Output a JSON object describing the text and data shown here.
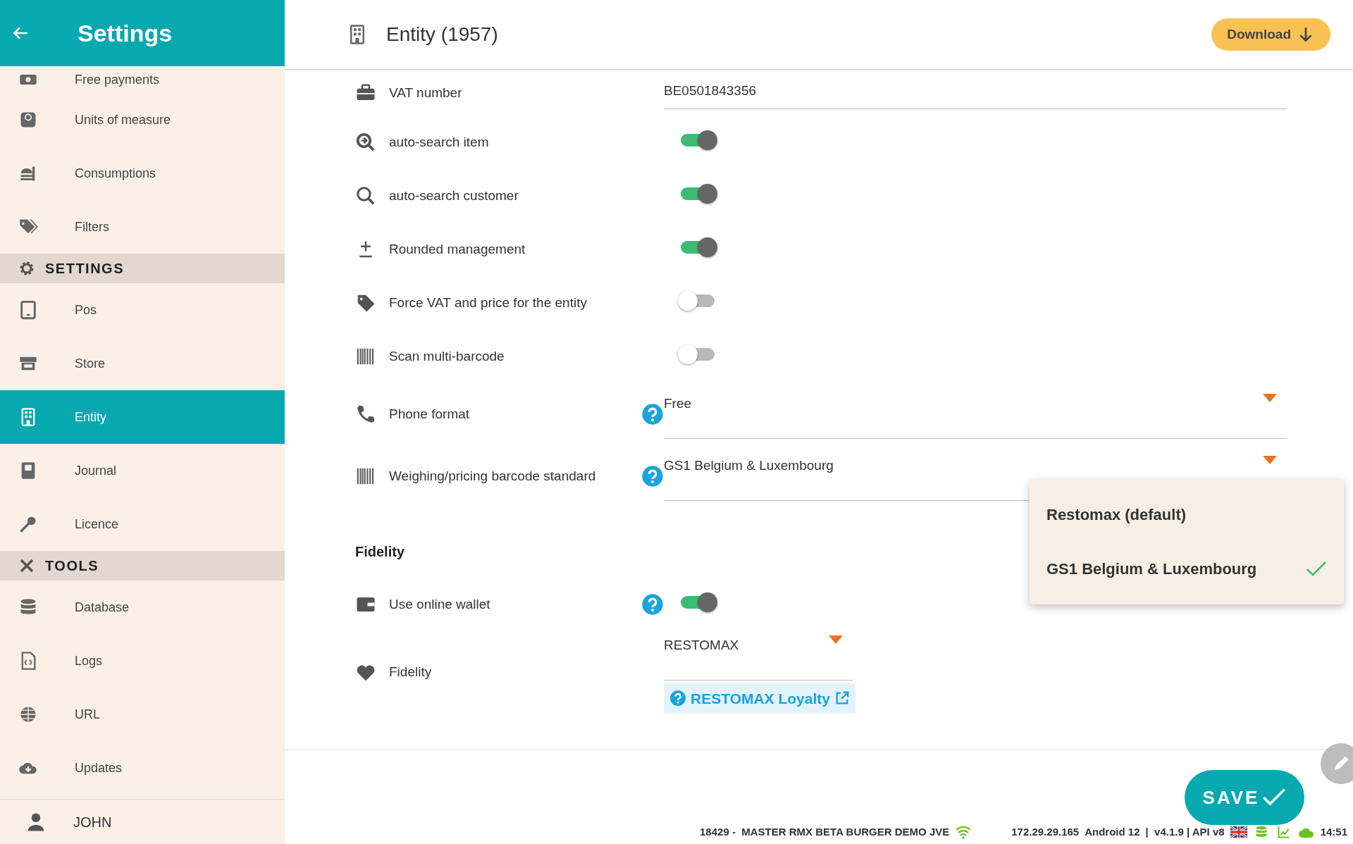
{
  "sidebar": {
    "title": "Settings",
    "items": [
      {
        "kind": "item",
        "label": "Free payments",
        "selected": false
      },
      {
        "kind": "item",
        "label": "Units of measure",
        "selected": false
      },
      {
        "kind": "item",
        "label": "Consumptions",
        "selected": false
      },
      {
        "kind": "item",
        "label": "Filters",
        "selected": false
      },
      {
        "kind": "section",
        "label": "SETTINGS"
      },
      {
        "kind": "item",
        "label": "Pos",
        "selected": false
      },
      {
        "kind": "item",
        "label": "Store",
        "selected": false
      },
      {
        "kind": "item",
        "label": "Entity",
        "selected": true
      },
      {
        "kind": "item",
        "label": "Journal",
        "selected": false
      },
      {
        "kind": "item",
        "label": "Licence",
        "selected": false
      },
      {
        "kind": "section",
        "label": "TOOLS"
      },
      {
        "kind": "item",
        "label": "Database",
        "selected": false
      },
      {
        "kind": "item",
        "label": "Logs",
        "selected": false
      },
      {
        "kind": "item",
        "label": "URL",
        "selected": false
      },
      {
        "kind": "item",
        "label": "Updates",
        "selected": false
      }
    ],
    "user": "JOHN"
  },
  "header": {
    "title": "Entity (1957)",
    "download_button": "Download"
  },
  "settings": [
    {
      "kind": "text",
      "label": "VAT number",
      "value": "BE0501843356",
      "help": false
    },
    {
      "kind": "toggle",
      "label": "auto-search item",
      "on": true,
      "help": false
    },
    {
      "kind": "toggle",
      "label": "auto-search customer",
      "on": true,
      "help": false
    },
    {
      "kind": "toggle",
      "label": "Rounded management",
      "on": true,
      "help": false
    },
    {
      "kind": "toggle",
      "label": "Force VAT and price for the entity",
      "on": false,
      "help": false
    },
    {
      "kind": "toggle",
      "label": "Scan multi-barcode",
      "on": false,
      "help": false
    },
    {
      "kind": "select",
      "label": "Phone format",
      "value": "Free",
      "help": true
    },
    {
      "kind": "select",
      "label": "Weighing/pricing barcode standard",
      "value": "GS1 Belgium & Luxembourg",
      "help": true
    }
  ],
  "dropdown": {
    "options": [
      {
        "label": "Restomax (default)",
        "selected": false
      },
      {
        "label": "GS1 Belgium & Luxembourg",
        "selected": true
      }
    ]
  },
  "fidelity": {
    "heading": "Fidelity",
    "rows": [
      {
        "kind": "toggle",
        "label": "Use online wallet",
        "on": true,
        "help": true
      },
      {
        "kind": "select",
        "label": "Fidelity",
        "value": "RESTOMAX",
        "help": false,
        "link": "RESTOMAX Loyalty"
      }
    ]
  },
  "save_button": "SAVE",
  "status_bar": {
    "terminal": "18429 -  MASTER RMX BETA BURGER DEMO JVE",
    "ip": "172.29.29.165",
    "os": "Android 12",
    "version": "|  v4.1.9 | API v8",
    "time": "14:51"
  }
}
